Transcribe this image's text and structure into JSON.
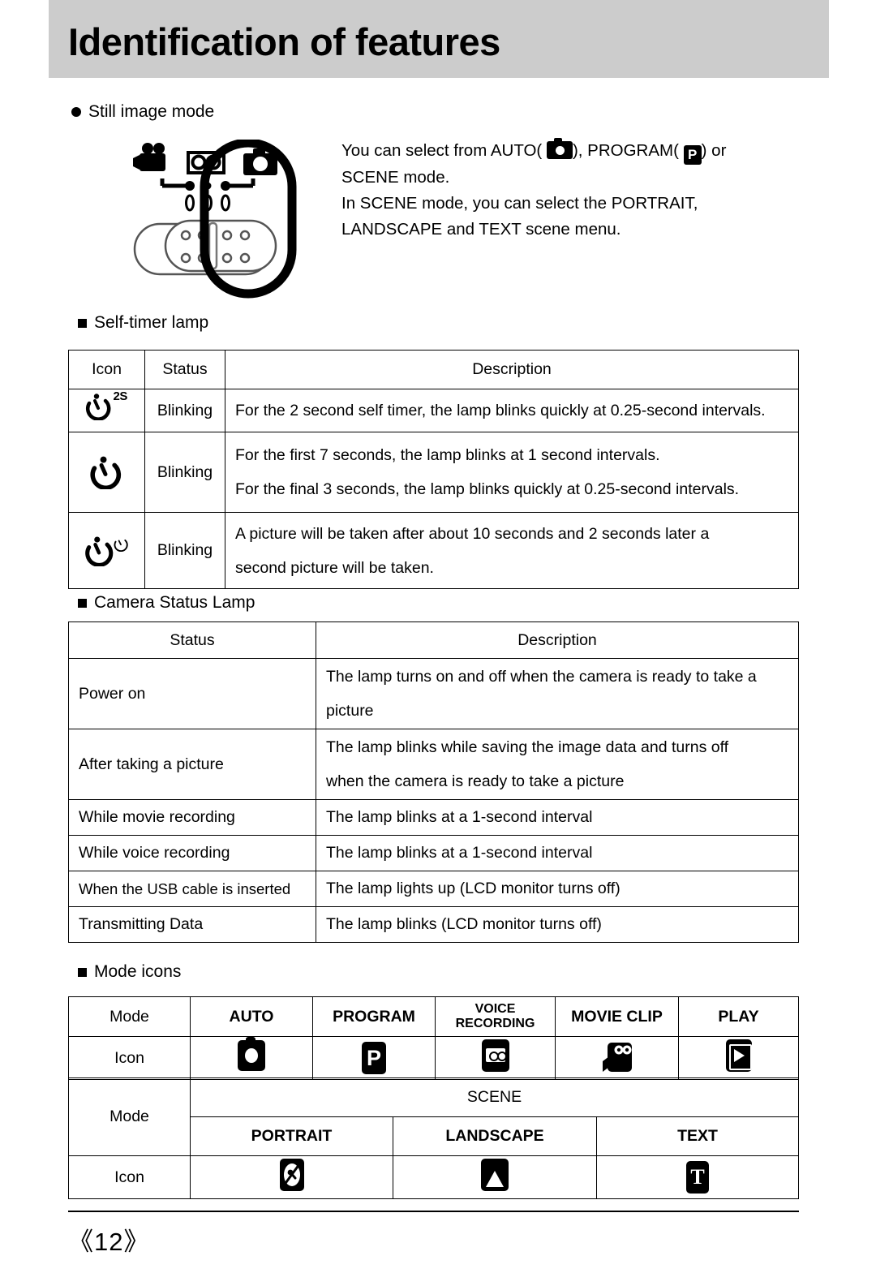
{
  "header": {
    "title": "Identification of features"
  },
  "still_image_mode": {
    "heading": "Still image mode",
    "paragraph_lines": [
      {
        "pre": "You can select from AUTO(",
        "icon1": "camera-mode-icon",
        "mid": "), PROGRAM(",
        "icon2": "program-mode-icon",
        "post": ") or"
      },
      {
        "text": "SCENE mode."
      },
      {
        "text": "In SCENE mode, you can select the PORTRAIT,"
      },
      {
        "text": "LANDSCAPE and TEXT scene menu."
      }
    ],
    "line_1_pre": "You can select from AUTO(",
    "line_1_mid": "), PROGRAM(",
    "line_1_post": ") or",
    "line_2": "SCENE mode.",
    "line_3": "In SCENE mode, you can select the PORTRAIT,",
    "line_4": "LANDSCAPE and TEXT scene menu.",
    "dial_icons": [
      "movie-clip-dial-icon",
      "voice-recording-dial-icon",
      "still-camera-dial-icon"
    ]
  },
  "self_timer": {
    "heading": "Self-timer lamp",
    "columns": [
      "Icon",
      "Status",
      "Description"
    ],
    "rows": [
      {
        "icon": "self-timer-2s-icon",
        "icon_sup": "2S",
        "status": "Blinking",
        "description_lines": [
          "For the 2 second self timer, the lamp blinks quickly at 0.25-second intervals."
        ]
      },
      {
        "icon": "self-timer-10s-icon",
        "icon_sup": "",
        "status": "Blinking",
        "description_lines": [
          "For the first 7 seconds, the lamp blinks at 1 second intervals.",
          "For the final 3 seconds, the lamp blinks quickly at 0.25-second intervals."
        ]
      },
      {
        "icon": "self-timer-double-icon",
        "icon_sup": "clock",
        "status": "Blinking",
        "description_lines": [
          "A picture will be taken after about 10 seconds and 2 seconds later a",
          "second picture will be taken."
        ]
      }
    ]
  },
  "camera_status_lamp": {
    "heading": "Camera Status Lamp",
    "columns": [
      "Status",
      "Description"
    ],
    "rows": [
      {
        "status": "Power on",
        "description_lines": [
          "The lamp turns on and off when the camera is ready to take a",
          "picture"
        ]
      },
      {
        "status": "After taking a picture",
        "description_lines": [
          "The lamp blinks while saving the image data and turns off",
          "when the camera is ready to take a picture"
        ]
      },
      {
        "status": "While movie recording",
        "description_lines": [
          "The lamp blinks at a 1-second interval"
        ]
      },
      {
        "status": "While voice recording",
        "description_lines": [
          "The lamp blinks at a 1-second interval"
        ]
      },
      {
        "status": "When the USB cable is inserted",
        "description_lines": [
          "The lamp lights up (LCD monitor turns off)"
        ]
      },
      {
        "status": "Transmitting Data",
        "description_lines": [
          "The lamp blinks (LCD monitor turns off)"
        ]
      }
    ]
  },
  "mode_icons": {
    "heading": "Mode icons",
    "row_mode_label": "Mode",
    "row_icon_label": "Icon",
    "modes": [
      {
        "label": "AUTO",
        "icon": "auto-mode-icon"
      },
      {
        "label": "PROGRAM",
        "icon": "program-mode-icon"
      },
      {
        "label": "VOICE RECORDING",
        "icon": "voice-recording-mode-icon"
      },
      {
        "label": "MOVIE CLIP",
        "icon": "movie-clip-mode-icon"
      },
      {
        "label": "PLAY",
        "icon": "play-mode-icon"
      }
    ],
    "scene_group_label": "SCENE",
    "scene_modes": [
      {
        "label": "PORTRAIT",
        "icon": "portrait-scene-icon"
      },
      {
        "label": "LANDSCAPE",
        "icon": "landscape-scene-icon"
      },
      {
        "label": "TEXT",
        "icon": "text-scene-icon"
      }
    ]
  },
  "footer": {
    "page_number": "《12》"
  },
  "colors": {
    "header_band": "#cccccc",
    "ink": "#000000",
    "paper": "#ffffff"
  }
}
